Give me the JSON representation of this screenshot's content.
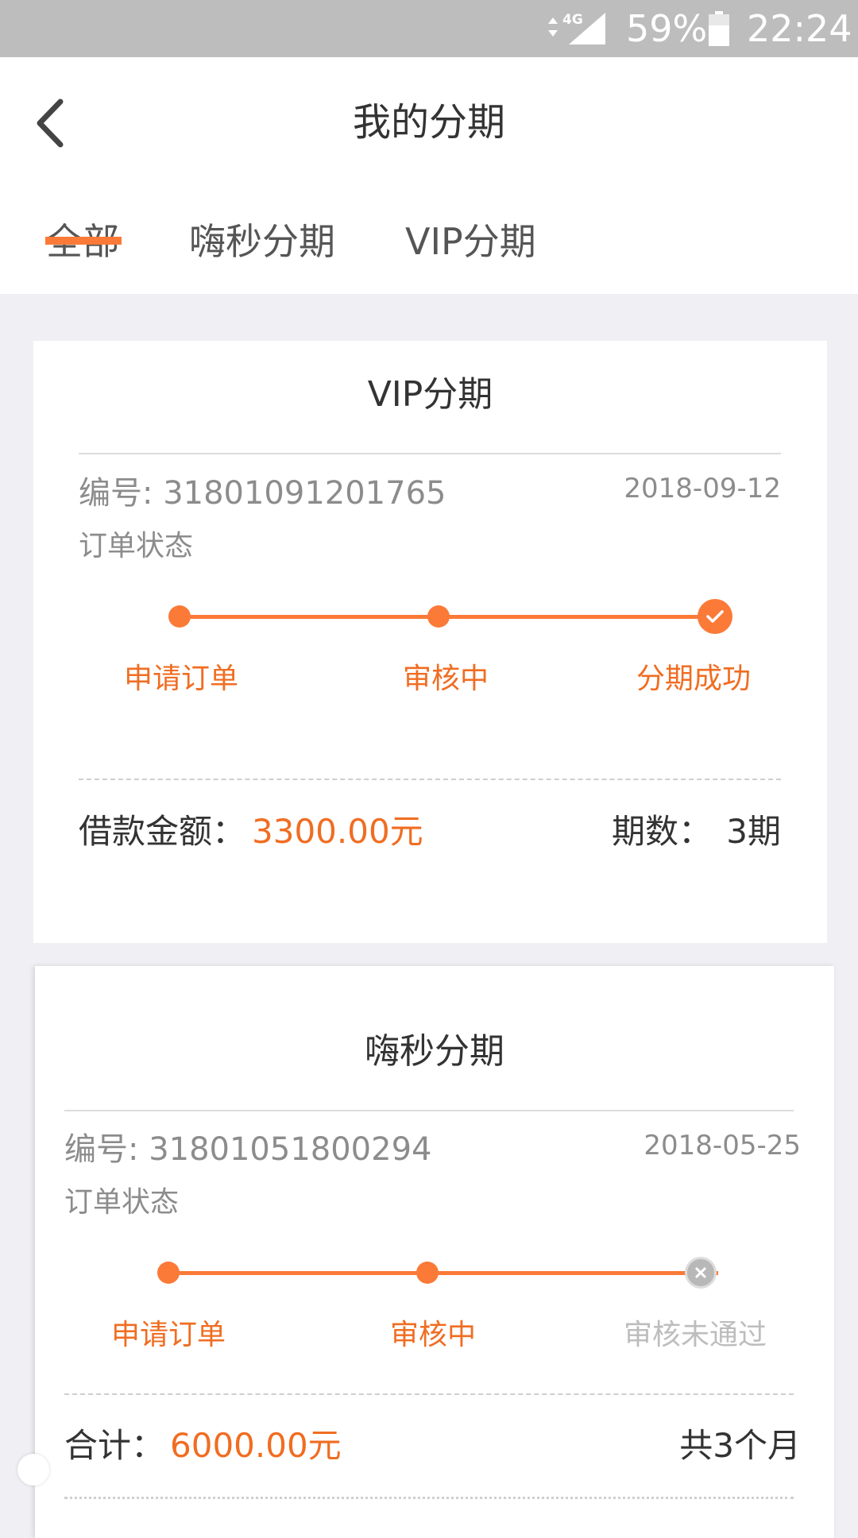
{
  "status_bar": {
    "network": "4G",
    "battery": "59%",
    "time": "22:24"
  },
  "header": {
    "title": "我的分期"
  },
  "tabs": [
    {
      "label": "全部",
      "active": true
    },
    {
      "label": "嗨秒分期",
      "active": false
    },
    {
      "label": "VIP分期",
      "active": false
    }
  ],
  "orders": [
    {
      "title": "VIP分期",
      "order_no": "编号: 31801091201765",
      "date": "2018-09-12",
      "status_label": "订单状态",
      "steps": [
        "申请订单",
        "审核中",
        "分期成功"
      ],
      "result": "success",
      "amount_label": "借款金额：",
      "amount": "3300.00元",
      "period_label": "期数：",
      "period_value": "3期"
    },
    {
      "title": "嗨秒分期",
      "order_no": "编号: 31801051800294",
      "date": "2018-05-25",
      "status_label": "订单状态",
      "steps": [
        "申请订单",
        "审核中",
        "审核未通过"
      ],
      "result": "rejected",
      "amount_label": "合计：",
      "amount": "6000.00元",
      "duration": "共3个月"
    }
  ],
  "colors": {
    "accent": "#fb7a38",
    "accent_text": "#f06d22",
    "fail_grey": "#bdbdbd",
    "background": "#efeff4"
  },
  "icons": [
    "back-arrow-icon",
    "signal-icon",
    "battery-icon",
    "check-icon",
    "close-icon"
  ]
}
